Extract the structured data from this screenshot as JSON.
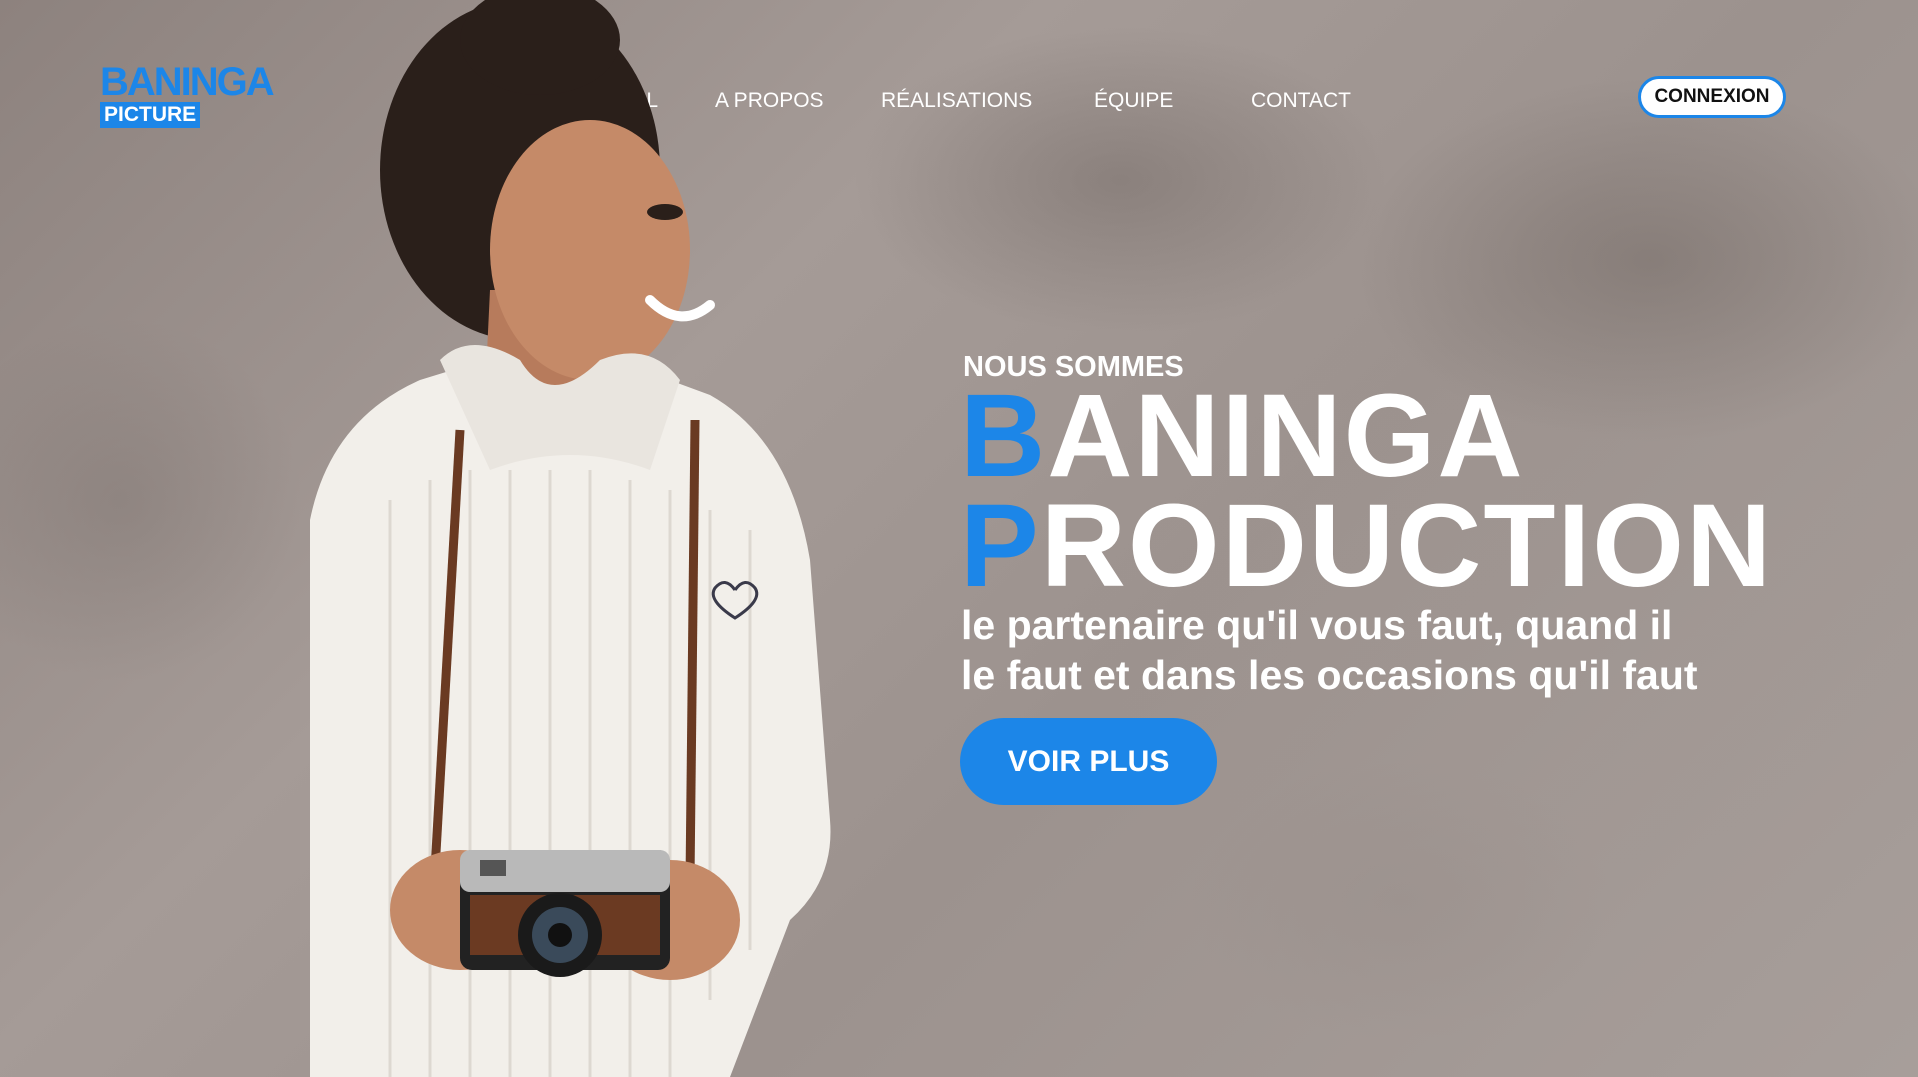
{
  "brand": {
    "logo_top": "BANINGA",
    "logo_bottom": "PICTURE",
    "accent_color": "#1c86e8"
  },
  "nav": {
    "items": [
      {
        "label": "ACCUEIL"
      },
      {
        "label": "A PROPOS"
      },
      {
        "label": "RÉALISATIONS"
      },
      {
        "label": "ÉQUIPE"
      },
      {
        "label": "CONTACT"
      }
    ]
  },
  "header": {
    "login_label": "CONNEXION"
  },
  "hero": {
    "kicker": "NOUS SOMMES",
    "title_line1_initial": "B",
    "title_line1_rest": "ANINGA",
    "title_line2_initial": "P",
    "title_line2_rest": "RODUCTION",
    "tagline": "le partenaire qu'il vous faut, quand il\nle faut et dans les occasions  qu'il faut",
    "cta_label": "VOIR PLUS",
    "image_subject": "woman-with-camera"
  }
}
